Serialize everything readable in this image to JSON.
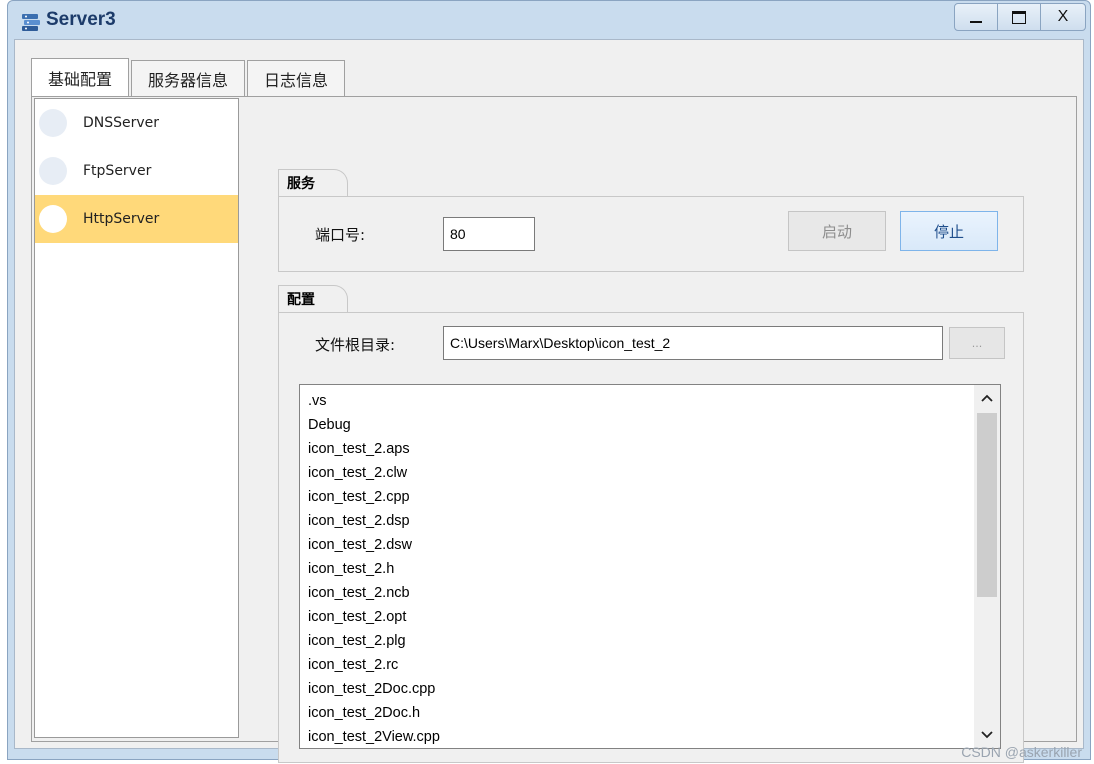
{
  "window": {
    "title": "Server3",
    "controls": {
      "minimize": "",
      "maximize": "",
      "close": "X"
    }
  },
  "tabs": [
    {
      "label": "基础配置",
      "active": true
    },
    {
      "label": "服务器信息",
      "active": false
    },
    {
      "label": "日志信息",
      "active": false
    }
  ],
  "sidebar": {
    "items": [
      {
        "label": "DNSServer",
        "selected": false
      },
      {
        "label": "FtpServer",
        "selected": false
      },
      {
        "label": "HttpServer",
        "selected": true
      }
    ]
  },
  "service": {
    "group_title": "服务",
    "port_label": "端口号:",
    "port_value": "80",
    "start_label": "启动",
    "stop_label": "停止"
  },
  "config": {
    "group_title": "配置",
    "root_label": "文件根目录:",
    "root_value": "C:\\Users\\Marx\\Desktop\\icon_test_2",
    "browse_label": "...",
    "files": [
      ".vs",
      "Debug",
      "icon_test_2.aps",
      "icon_test_2.clw",
      "icon_test_2.cpp",
      "icon_test_2.dsp",
      "icon_test_2.dsw",
      "icon_test_2.h",
      "icon_test_2.ncb",
      "icon_test_2.opt",
      "icon_test_2.plg",
      "icon_test_2.rc",
      "icon_test_2Doc.cpp",
      "icon_test_2Doc.h",
      "icon_test_2View.cpp"
    ]
  },
  "scrollbar": {
    "up_icon": "chevron-up-icon",
    "down_icon": "chevron-down-icon"
  },
  "watermark": "CSDN @askerkiller",
  "colors": {
    "selected_item": "#ffd97a",
    "window_frame": "#c9dcee"
  }
}
